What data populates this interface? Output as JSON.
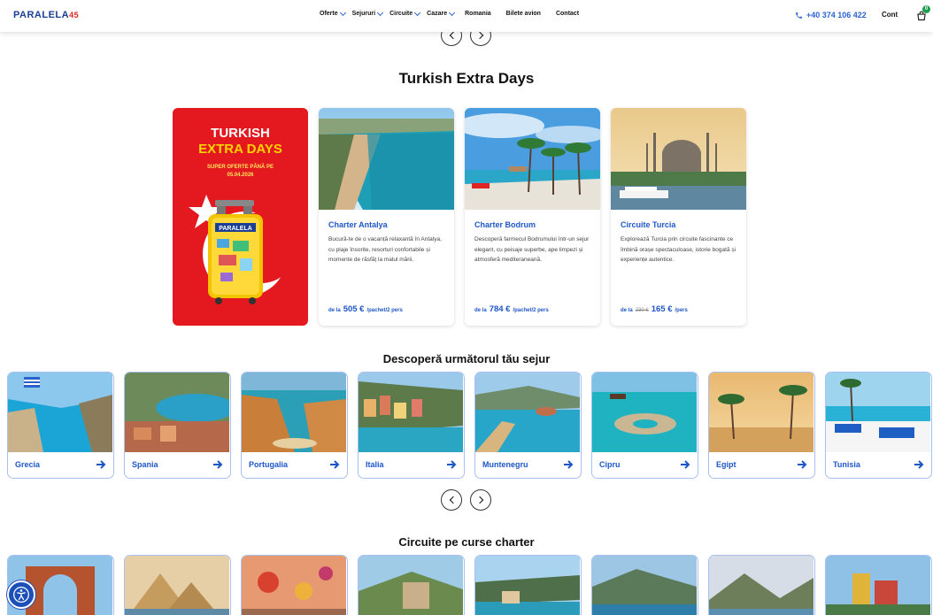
{
  "header": {
    "logo_text": "PARALELA",
    "logo_number": "45",
    "nav": [
      {
        "label": "Oferte"
      },
      {
        "label": "Sejururi"
      },
      {
        "label": "Circuite"
      },
      {
        "label": "Cazare"
      }
    ],
    "nav_plain": [
      "Romania",
      "Bilete avion",
      "Contact"
    ],
    "phone": "+40 374 106 422",
    "account": "Cont",
    "cart_count": "0"
  },
  "turkish": {
    "title": "Turkish Extra Days",
    "promo": {
      "line1": "TURKISH",
      "line2": "EXTRA DAYS",
      "line3": "SUPER OFERTE PÂNĂ PE",
      "line4": "05.04.2026"
    },
    "offers": [
      {
        "title": "Charter Antalya",
        "desc": "Bucură-te de o vacanță relaxantă în Antalya, cu plaje însorite, resorturi confortabile și momente de răsfăț la malul mării.",
        "from": "de la",
        "old": "",
        "price": "505 €",
        "unit": "/pachet/2 pers"
      },
      {
        "title": "Charter Bodrum",
        "desc": "Descoperă farmecul Bodrumului într-un sejur elegant, cu peisaje superbe, ape limpezi și atmosferă mediteraneană.",
        "from": "de la",
        "old": "",
        "price": "784 €",
        "unit": "/pachet/2 pers"
      },
      {
        "title": "Circuite Turcia",
        "desc": "Explorează Turcia prin circuite fascinante ce îmbină orașe spectaculoase, istorie bogată și experiențe autentice.",
        "from": "de la",
        "old": "230 €",
        "price": "165 €",
        "unit": "/pers"
      }
    ]
  },
  "destinations": {
    "title": "Descoperă următorul tău sejur",
    "items": [
      "Grecia",
      "Spania",
      "Portugalia",
      "Italia",
      "Muntenegru",
      "Cipru",
      "Egipt",
      "Tunisia"
    ]
  },
  "circuits": {
    "title": "Circuite pe curse charter"
  },
  "colors": {
    "brand_blue": "#1e56c8",
    "promo_red": "#e3191f",
    "accent_yellow": "#ffd200"
  }
}
